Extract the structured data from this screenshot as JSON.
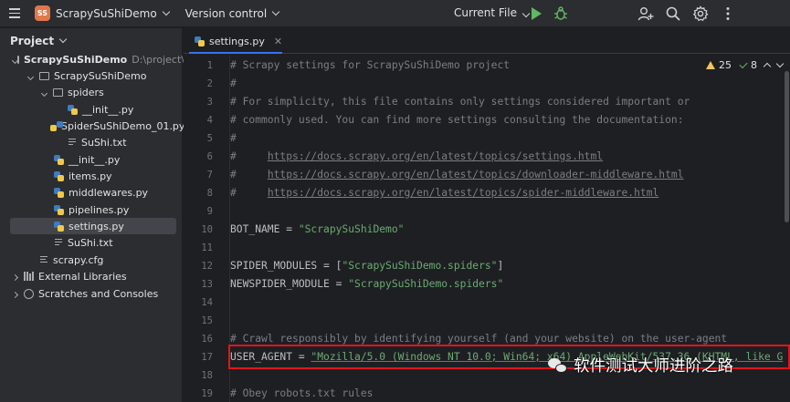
{
  "titlebar": {
    "project_badge": "SS",
    "project_name": "ScrapySuShiDemo",
    "vcs_label": "Version control",
    "run_config": "Current File"
  },
  "project_panel": {
    "title": "Project",
    "tree": [
      {
        "label": "ScrapySuShiDemo",
        "path": "D:\\project\\Pyth",
        "icon": "folder-icon",
        "arrow": "down",
        "bold": true
      },
      {
        "label": "ScrapySuShiDemo",
        "icon": "folder-icon",
        "arrow": "down"
      },
      {
        "label": "spiders",
        "icon": "folder-icon",
        "arrow": "down"
      },
      {
        "label": "__init__.py",
        "icon": "python-file-icon"
      },
      {
        "label": "SpiderSuShiDemo_01.py",
        "icon": "python-file-icon"
      },
      {
        "label": "SuShi.txt",
        "icon": "text-file-icon"
      },
      {
        "label": "__init__.py",
        "icon": "python-file-icon"
      },
      {
        "label": "items.py",
        "icon": "python-file-icon"
      },
      {
        "label": "middlewares.py",
        "icon": "python-file-icon"
      },
      {
        "label": "pipelines.py",
        "icon": "python-file-icon"
      },
      {
        "label": "settings.py",
        "icon": "python-file-icon",
        "selected": true
      },
      {
        "label": "SuShi.txt",
        "icon": "text-file-icon"
      },
      {
        "label": "scrapy.cfg",
        "icon": "config-file-icon"
      },
      {
        "label": "External Libraries",
        "icon": "library-icon",
        "arrow": "right"
      },
      {
        "label": "Scratches and Consoles",
        "icon": "scratches-icon",
        "arrow": "right"
      }
    ]
  },
  "editor": {
    "tab_label": "settings.py",
    "warnings_count": "25",
    "ok_count": "8",
    "line_numbers": [
      "1",
      "2",
      "3",
      "4",
      "5",
      "6",
      "7",
      "8",
      "9",
      "10",
      "11",
      "12",
      "13",
      "14",
      "15",
      "16",
      "17",
      "18",
      "19"
    ],
    "lines": {
      "l1": "# Scrapy settings for ScrapySuShiDemo project",
      "l2": "#",
      "l3": "# For simplicity, this file contains only settings considered important or",
      "l4": "# commonly used. You can find more settings consulting the documentation:",
      "l5": "#",
      "l6_prefix": "#     ",
      "l6_url": "https://docs.scrapy.org/en/latest/topics/settings.html",
      "l7_prefix": "#     ",
      "l7_url": "https://docs.scrapy.org/en/latest/topics/downloader-middleware.html",
      "l8_prefix": "#     ",
      "l8_url": "https://docs.scrapy.org/en/latest/topics/spider-middleware.html",
      "l10_name": "BOT_NAME = ",
      "l10_value": "\"ScrapySuShiDemo\"",
      "l12_name": "SPIDER_MODULES = [",
      "l12_value": "\"ScrapySuShiDemo.spiders\"",
      "l12_end": "]",
      "l13_name": "NEWSPIDER_MODULE = ",
      "l13_value": "\"ScrapySuShiDemo.spiders\"",
      "l16": "# Crawl responsibly by identifying yourself (and your website) on the user-agent",
      "l17_name": "USER_AGENT = ",
      "l17_value": "\"Mozilla/5.0 (Windows NT 10.0; Win64; x64) AppleWebKit/537.36 (KHTML, like G",
      "l19": "# Obey robots.txt rules"
    }
  },
  "watermark": {
    "text": "软件测试大师进阶之路"
  },
  "colors": {
    "highlight_border": "#e0141c",
    "string": "#6aab73",
    "comment": "#7a7e85",
    "selection": "#43454a",
    "accent": "#3574f0"
  }
}
